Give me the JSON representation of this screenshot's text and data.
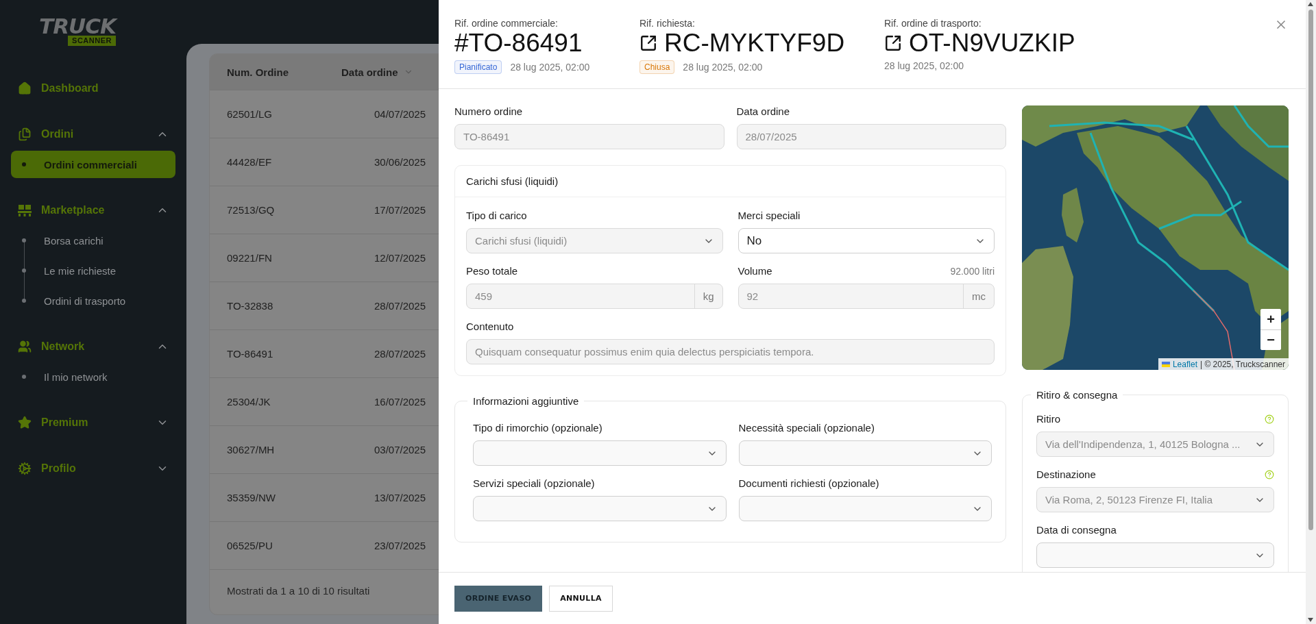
{
  "logo": {
    "word": "TRUCK",
    "sub": "SCANNER"
  },
  "sidebar": {
    "items": [
      {
        "label": "Dashboard",
        "kind": "link"
      },
      {
        "label": "Ordini",
        "kind": "group",
        "expanded": true,
        "children": [
          {
            "label": "Ordini commerciali",
            "selected": true
          }
        ]
      },
      {
        "label": "Marketplace",
        "kind": "group",
        "expanded": true,
        "children": [
          {
            "label": "Borsa carichi",
            "selected": false
          },
          {
            "label": "Le mie richieste",
            "selected": false
          },
          {
            "label": "Ordini di trasporto",
            "selected": false
          }
        ]
      },
      {
        "label": "Network",
        "kind": "group",
        "expanded": true,
        "children": [
          {
            "label": "Il mio network",
            "selected": false
          }
        ]
      },
      {
        "label": "Premium",
        "kind": "group",
        "expanded": false
      },
      {
        "label": "Profilo",
        "kind": "group",
        "expanded": false
      }
    ]
  },
  "table": {
    "columns": [
      {
        "label": "Num. Ordine",
        "sorted": false
      },
      {
        "label": "Data ordine",
        "sorted": true
      }
    ],
    "rows": [
      [
        "62501/LG",
        "04/07/2025"
      ],
      [
        "44428/EF",
        "30/06/2025"
      ],
      [
        "72513/GQ",
        "17/07/2025"
      ],
      [
        "09221/FN",
        "12/07/2025"
      ],
      [
        "TO-32838",
        "28/07/2025"
      ],
      [
        "TO-86491",
        "28/07/2025"
      ],
      [
        "25304/JK",
        "16/07/2025"
      ],
      [
        "30627/MH",
        "03/07/2025"
      ],
      [
        "35359/NW",
        "13/07/2025"
      ],
      [
        "06525/PU",
        "23/07/2025"
      ]
    ],
    "footer": "Mostrati da 1 a 10 di 10 risultati"
  },
  "drawer": {
    "refs": [
      {
        "label": "Rif. ordine commerciale:",
        "id": "#TO-86491",
        "kind": "plain",
        "badge": {
          "text": "Pianificato",
          "color": "#3567d6"
        },
        "date": "28 lug 2025, 02:00"
      },
      {
        "label": "Rif. richiesta:",
        "id": "RC-MYKTYF9D",
        "kind": "link",
        "badge": {
          "text": "Chiusa",
          "color": "#d97706"
        },
        "date": "28 lug 2025, 02:00"
      },
      {
        "label": "Rif. ordine di trasporto:",
        "id": "OT-N9VUZKIP",
        "kind": "link",
        "date": "28 lug 2025, 02:00"
      }
    ],
    "order_fields": [
      {
        "label": "Numero ordine",
        "value": "TO-86491",
        "disabled": true
      },
      {
        "label": "Data ordine",
        "value": "28/07/2025",
        "disabled": true
      }
    ],
    "load_section": {
      "title": "Carichi sfusi (liquidi)",
      "fields": [
        {
          "label": "Tipo di carico",
          "value": "Carichi sfusi (liquidi)",
          "kind": "select",
          "disabled": true
        },
        {
          "label": "Merci speciali",
          "value": "No",
          "kind": "select",
          "disabled": false
        },
        {
          "label": "Peso totale",
          "value": "459",
          "unit": "kg",
          "kind": "unit",
          "disabled": true
        },
        {
          "label": "Volume",
          "value": "92",
          "unit": "mc",
          "hint": "92.000 litri",
          "kind": "unit",
          "disabled": true
        },
        {
          "label": "Contenuto",
          "value": "Quisquam consequatur possimus enim quia delectus perspiciatis tempora.",
          "kind": "wide",
          "disabled": true
        }
      ]
    },
    "extra_section": {
      "title": "Informazioni aggiuntive",
      "fields": [
        {
          "label": "Tipo di rimorchio (opzionale)",
          "kind": "select"
        },
        {
          "label": "Necessità speciali (opzionale)",
          "kind": "select"
        },
        {
          "label": "Servizi speciali (opzionale)",
          "kind": "select"
        },
        {
          "label": "Documenti richiesti (opzionale)",
          "kind": "select"
        }
      ]
    },
    "map": {
      "zoom_in": "+",
      "zoom_out": "−",
      "attribution_link": "Leaflet",
      "attribution": "| © 2025, Truckscanner"
    },
    "route_section": {
      "title": "Ritiro & consegna",
      "fields": [
        {
          "label": "Ritiro",
          "value": "Via dell'Indipendenza, 1, 40125 Bologna ...",
          "help": true,
          "disabled": true
        },
        {
          "label": "Destinazione",
          "value": "Via Roma, 2, 50123 Firenze FI, Italia",
          "help": true,
          "disabled": true
        },
        {
          "label": "Data di consegna",
          "help": false
        }
      ]
    },
    "buttons": [
      {
        "label": "ORDINE EVASO",
        "kind": "primary"
      },
      {
        "label": "ANNULLA",
        "kind": "secondary"
      }
    ]
  }
}
